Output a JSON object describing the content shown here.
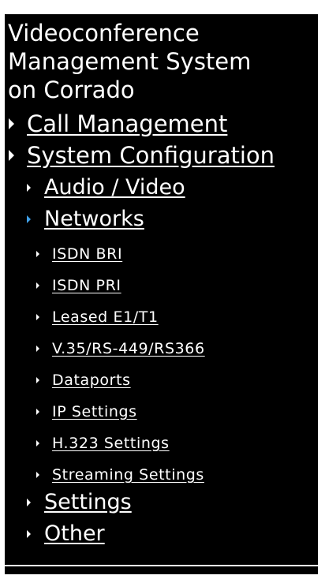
{
  "title": {
    "line1": "Videoconference",
    "line2": "Management System",
    "line3": "on Corrado"
  },
  "nav": {
    "call_management": "Call Management",
    "system_configuration": "System Configuration",
    "audio_video": "Audio / Video",
    "networks": "Networks",
    "isdn_bri": "ISDN BRI",
    "isdn_pri": "ISDN PRI",
    "leased": "Leased E1/T1",
    "v35": "V.35/RS-449/RS366",
    "dataports": "Dataports",
    "ip_settings": "IP Settings",
    "h323_settings": "H.323 Settings",
    "streaming_settings": "Streaming Settings",
    "settings": "Settings",
    "other": "Other"
  },
  "colors": {
    "background": "#000000",
    "text": "#ffffff",
    "active_bullet": "#3fa0e8"
  }
}
